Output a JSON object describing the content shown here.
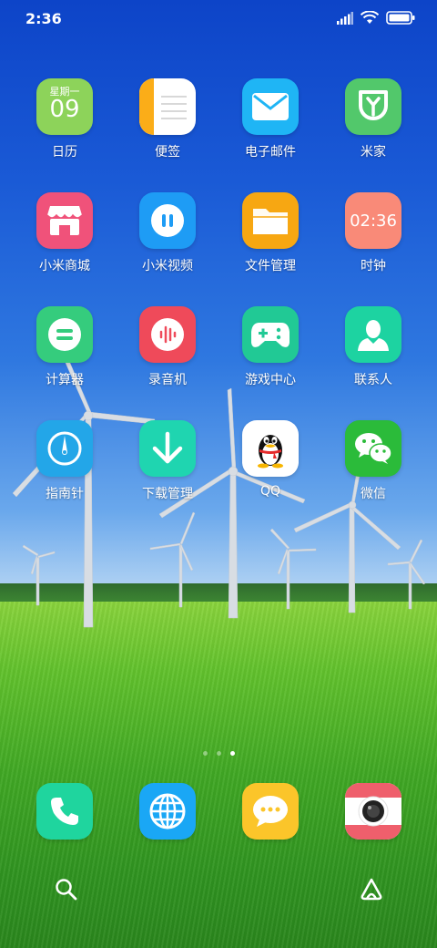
{
  "status_bar": {
    "time": "2:36",
    "icons": [
      "signal-icon",
      "wifi-icon",
      "battery-icon"
    ]
  },
  "calendar": {
    "weekday": "星期一",
    "day": "09"
  },
  "clock": {
    "time": "02:36"
  },
  "apps": {
    "calendar": "日历",
    "notes": "便签",
    "email": "电子邮件",
    "mijia": "米家",
    "mi_store": "小米商城",
    "mi_video": "小米视频",
    "file_manager": "文件管理",
    "clock": "时钟",
    "calculator": "计算器",
    "recorder": "录音机",
    "game_center": "游戏中心",
    "contacts": "联系人",
    "compass": "指南针",
    "downloads": "下载管理",
    "qq": "QQ",
    "wechat": "微信"
  },
  "page_indicator": {
    "pages": 3,
    "active": 3
  },
  "dock": [
    "phone-icon",
    "browser-icon",
    "messages-icon",
    "camera-icon"
  ],
  "colors": {
    "calendar": "#8dd35a",
    "notes_accent": "#fbad18",
    "email": "#1fb5f5",
    "mijia": "#52c86b",
    "mi_store": "#f0527a",
    "mi_video": "#1e9cf5",
    "file_manager": "#f7a712",
    "clock": "#f98a78",
    "calculator": "#35cc7d",
    "recorder": "#ef4a5a",
    "game_center": "#21c995",
    "contacts": "#1dd3a1",
    "compass": "#23a6e8",
    "downloads": "#1fd5b0",
    "qq": "#ffffff",
    "wechat": "#2bbb3a",
    "phone": "#1fd59e",
    "browser": "#1aa7f5",
    "messages": "#fbc52a",
    "camera": "#ef5f6c"
  }
}
